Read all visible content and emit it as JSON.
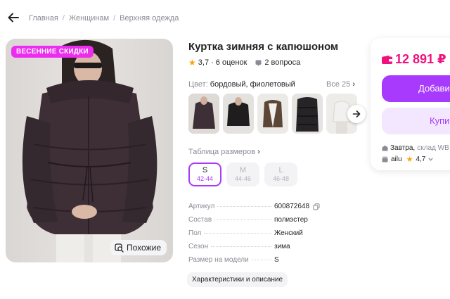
{
  "breadcrumb": {
    "items": [
      "Главная",
      "Женщинам",
      "Верхняя одежда"
    ],
    "separator": "/"
  },
  "product": {
    "title": "Куртка зимняя с капюшоном",
    "rating": "3,7",
    "reviews": "· 6 оценок",
    "questions": "2 вопроса",
    "promo_badge": "ВЕСЕННИЕ СКИДКИ",
    "similar_label": "Похожие"
  },
  "colors": {
    "label": "Цвет:",
    "value": "бордовый, фиолетовый",
    "all_link": "Все 25",
    "thumbnail_count": 5,
    "selected_index": 0
  },
  "sizes": {
    "table_link": "Таблица размеров",
    "items": [
      {
        "name": "S",
        "range": "42-44",
        "selected": true
      },
      {
        "name": "M",
        "range": "44-46",
        "selected": false
      },
      {
        "name": "L",
        "range": "46-48",
        "selected": false
      }
    ]
  },
  "specs": [
    {
      "key": "Артикул",
      "value": "600872648"
    },
    {
      "key": "Состав",
      "value": "полиэстер"
    },
    {
      "key": "Пол",
      "value": "Женский"
    },
    {
      "key": "Сезон",
      "value": "зима"
    },
    {
      "key": "Размер на модели",
      "value": "S"
    }
  ],
  "description_button": "Характеристики и описание",
  "buy_card": {
    "price": "12 891 ₽",
    "add_button": "Добави",
    "buy_button": "Купи",
    "delivery_day": "Завтра,",
    "delivery_place": "склад WB",
    "seller_name": "ailu",
    "seller_rating": "4,7"
  },
  "colors_theme": {
    "accent": "#a73afd",
    "price": "#f1117e",
    "promo": "#ec2df0",
    "star": "#ff9f0a"
  }
}
